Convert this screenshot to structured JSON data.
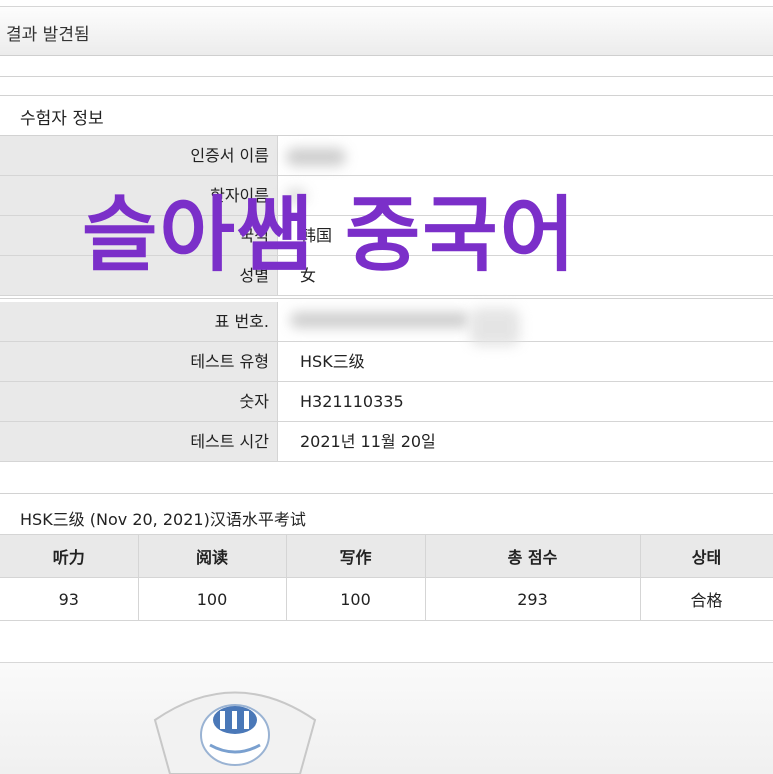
{
  "header": {
    "title": "결과 발견됨"
  },
  "candidate_section": {
    "title": "수험자 정보",
    "rows": [
      {
        "label": "인증서 이름",
        "value": ""
      },
      {
        "label": "한자이름",
        "value": ""
      },
      {
        "label": "국적",
        "value": "韩国"
      },
      {
        "label": "성별",
        "value": "女"
      }
    ]
  },
  "exam_rows": [
    {
      "label": "표 번호.",
      "value": ""
    },
    {
      "label": "테스트 유형",
      "value": "HSK三级"
    },
    {
      "label": "숫자",
      "value": "H321110335"
    },
    {
      "label": "테스트 시간",
      "value": "2021년 11월 20일"
    }
  ],
  "score_section": {
    "title": "HSK三级 (Nov 20, 2021)汉语水平考试",
    "headers": [
      "听力",
      "阅读",
      "写作",
      "총 점수",
      "상태"
    ],
    "values": [
      "93",
      "100",
      "100",
      "293",
      "合格"
    ]
  },
  "watermark": {
    "text": "슬아쌤 중국어",
    "color": "#7b2fc9"
  },
  "footer": {
    "logo_icon": "seal-logo-icon"
  }
}
